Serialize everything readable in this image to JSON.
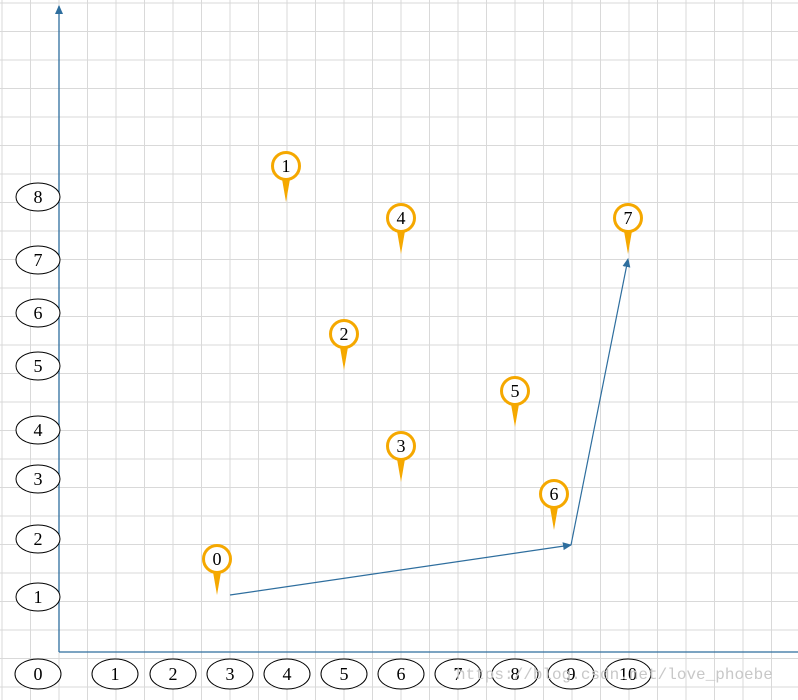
{
  "colors": {
    "grid": "#d9d9d9",
    "axis": "#2e6e9e",
    "marker": "#f5a800",
    "ellipse_stroke": "#000000"
  },
  "x_axis_labels": [
    "0",
    "1",
    "2",
    "3",
    "4",
    "5",
    "6",
    "7",
    "8",
    "9",
    "10"
  ],
  "y_axis_labels": [
    "1",
    "2",
    "3",
    "4",
    "5",
    "6",
    "7",
    "8"
  ],
  "markers": [
    {
      "label": "0",
      "x": 3,
      "y": 1
    },
    {
      "label": "1",
      "x": 4,
      "y": 8
    },
    {
      "label": "2",
      "x": 5,
      "y": 5
    },
    {
      "label": "3",
      "x": 6,
      "y": 3
    },
    {
      "label": "4",
      "x": 6,
      "y": 7
    },
    {
      "label": "5",
      "x": 8,
      "y": 4
    },
    {
      "label": "6",
      "x": 9,
      "y": 2
    },
    {
      "label": "7",
      "x": 10,
      "y": 7
    }
  ],
  "path": [
    [
      3,
      1
    ],
    [
      9,
      2
    ],
    [
      10,
      7
    ]
  ],
  "watermark": "https://blog.csdn.net/love_phoebe"
}
